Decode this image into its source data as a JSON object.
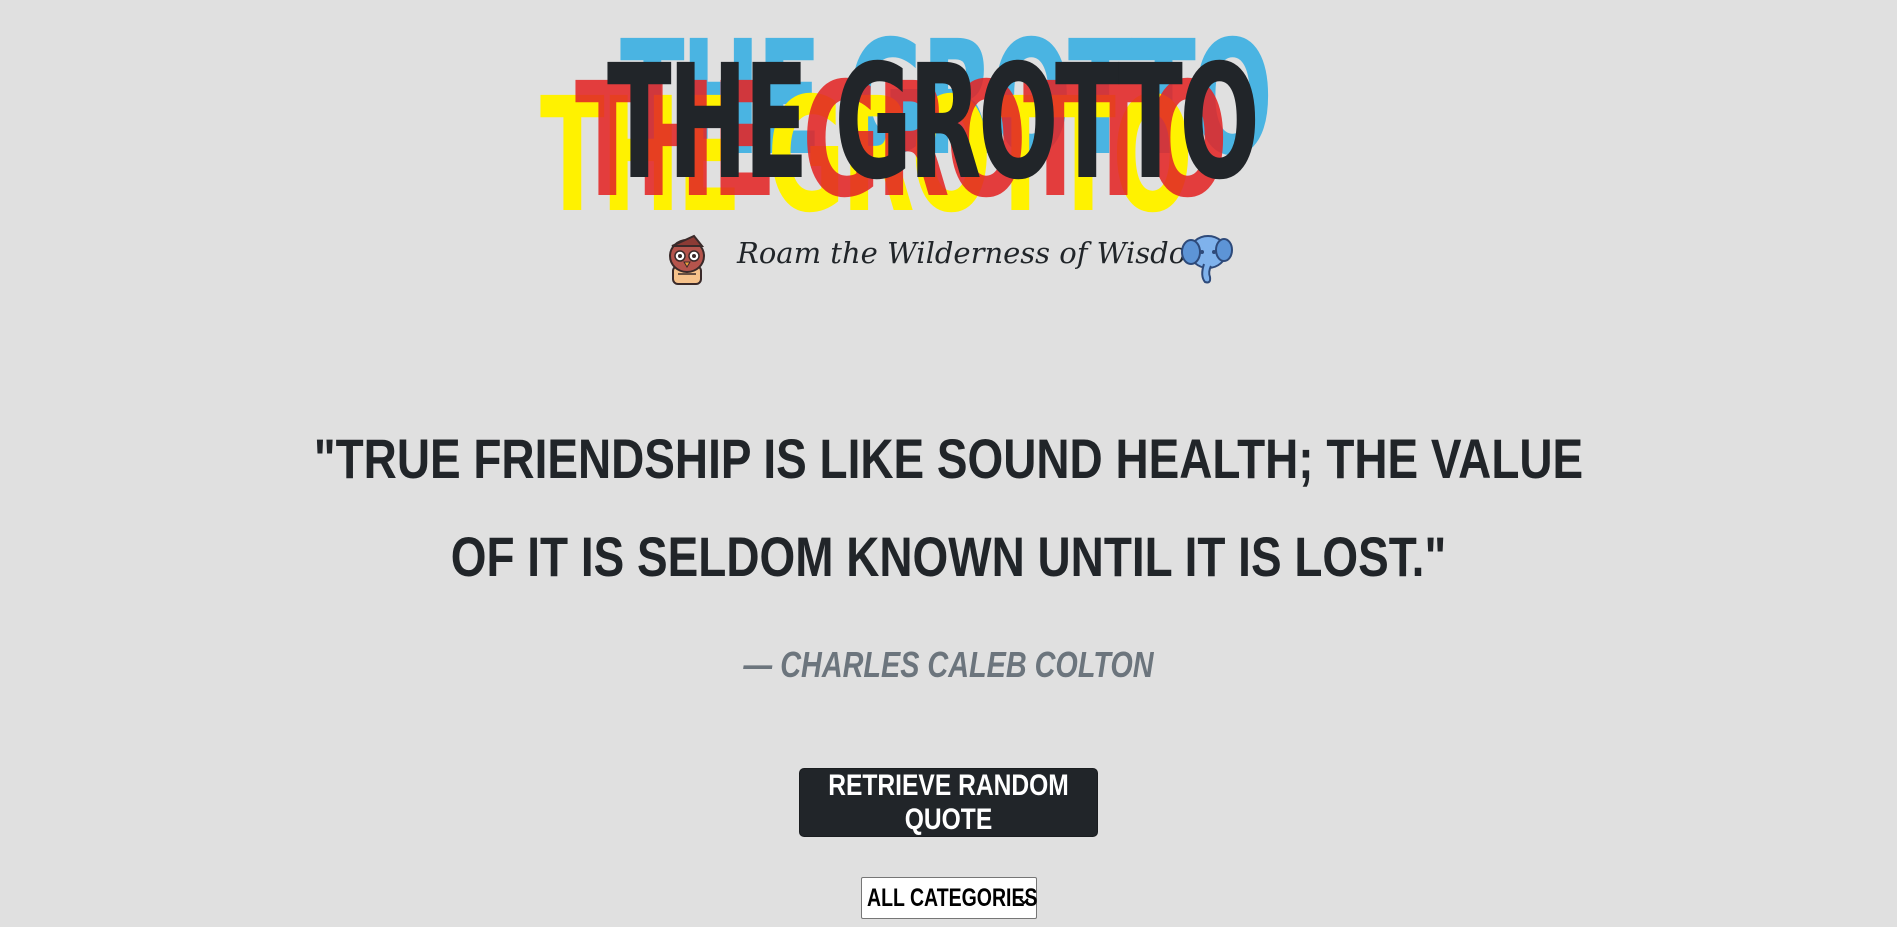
{
  "header": {
    "logo_text": "THE GROTTO",
    "tagline": "Roam the Wilderness of Wisdom",
    "left_icon": "owl-icon",
    "right_icon": "elephant-icon",
    "logo_colors": {
      "blue": "#4ab4e2",
      "yellow": "#fff200",
      "red": "#e22626",
      "black": "#212529"
    }
  },
  "quote": {
    "text": "\"TRUE FRIENDSHIP IS LIKE SOUND HEALTH; THE VALUE OF IT IS SELDOM KNOWN UNTIL IT IS LOST.\"",
    "author_dash": "—",
    "author": "CHARLES CALEB COLTON"
  },
  "actions": {
    "random_button_label": "RETRIEVE RANDOM QUOTE",
    "category_select": {
      "selected": "ALL CATEGORIES",
      "icon": "chevron-down-icon"
    }
  },
  "colors": {
    "background": "#e0e0e0",
    "text": "#212529",
    "author": "#6c757d",
    "button_bg": "#212529",
    "button_text": "#ffffff"
  }
}
